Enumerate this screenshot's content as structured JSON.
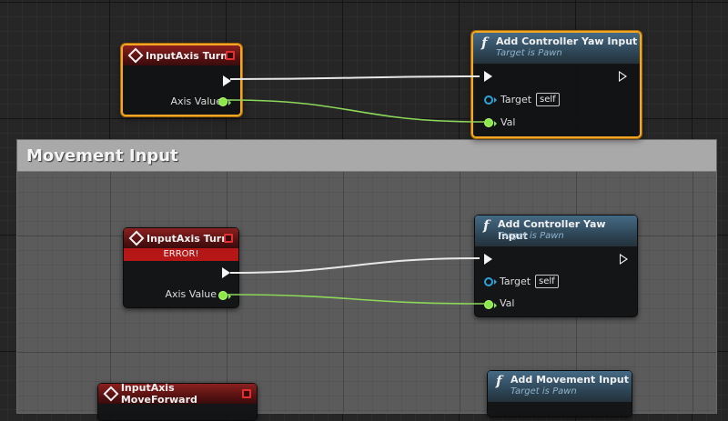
{
  "colors": {
    "event_header": "#6b1818",
    "function_header": "#3a5a72",
    "selection": "#f5a623",
    "exec_wire": "#e8e8e8",
    "float_wire": "#8cd85a",
    "float_pin": "#8ce84a",
    "object_pin": "#2ea2d9",
    "error_bar": "#b51616",
    "comment_header": "#a9a9a9"
  },
  "comment": {
    "title": "Movement Input"
  },
  "nodes": {
    "turn_event_top": {
      "title": "InputAxis Turn",
      "icon": "event-diamond-icon",
      "output_label": "Axis Value",
      "selected": true
    },
    "yaw_top": {
      "title": "Add Controller Yaw Input",
      "subtitle": "Target is Pawn",
      "icon": "function-icon",
      "target_label": "Target",
      "target_default": "self",
      "val_label": "Val",
      "selected": true
    },
    "turn_event_mid": {
      "title": "InputAxis Turn",
      "error": "ERROR!",
      "icon": "event-diamond-icon",
      "output_label": "Axis Value"
    },
    "yaw_mid": {
      "title": "Add Controller Yaw Input",
      "subtitle": "Target is Pawn",
      "icon": "function-icon",
      "target_label": "Target",
      "target_default": "self",
      "val_label": "Val"
    },
    "moveforward_event": {
      "title": "InputAxis MoveForward",
      "icon": "event-diamond-icon"
    },
    "add_movement": {
      "title": "Add Movement Input",
      "subtitle": "Target is Pawn",
      "icon": "function-icon"
    }
  }
}
